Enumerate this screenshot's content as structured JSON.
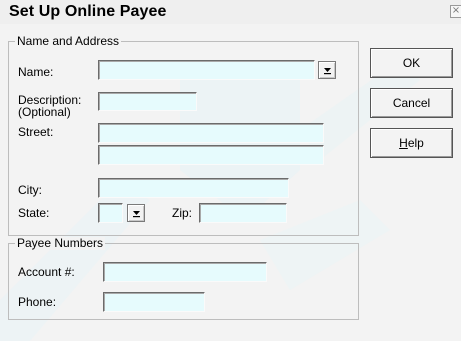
{
  "dialog": {
    "title": "Set Up Online Payee",
    "close_glyph": "×"
  },
  "name_address": {
    "legend": "Name and Address",
    "name_label": "Name:",
    "name_value": "",
    "description_label_1": "Description:",
    "description_label_2": "(Optional)",
    "description_value": "",
    "street_label": "Street:",
    "street_line1": "",
    "street_line2": "",
    "city_label": "City:",
    "city_value": "",
    "state_label": "State:",
    "state_value": "",
    "zip_label": "Zip:",
    "zip_value": ""
  },
  "payee_numbers": {
    "legend": "Payee Numbers",
    "account_label": "Account #:",
    "account_value": "",
    "phone_label": "Phone:",
    "phone_value": ""
  },
  "buttons": {
    "ok": "OK",
    "cancel": "Cancel",
    "help_mnemonic": "H",
    "help_rest": "elp"
  },
  "icons": {
    "dropdown": "dropdown-arrow-icon",
    "close": "close-icon"
  },
  "colors": {
    "field_background": "#e6fbfd",
    "dialog_background": "#f3f3f3"
  }
}
